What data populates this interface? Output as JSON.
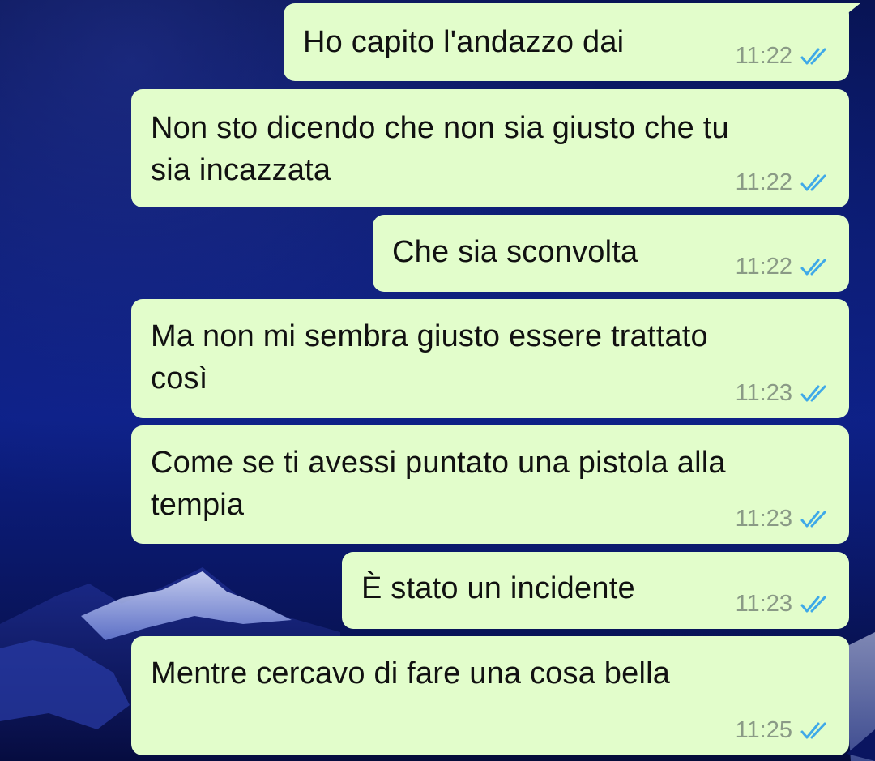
{
  "theme": {
    "bubble_color": "#e2fdcb",
    "read_tick_color": "#3fa9e8",
    "time_color": "#8a9a86"
  },
  "messages": [
    {
      "text": "Ho capito l'andazzo dai",
      "time": "11:22",
      "status_icon": "double-check-read-icon"
    },
    {
      "text": "Non sto dicendo che non sia giusto che tu\nsia incazzata",
      "time": "11:22",
      "status_icon": "double-check-read-icon"
    },
    {
      "text": "Che sia sconvolta",
      "time": "11:22",
      "status_icon": "double-check-read-icon"
    },
    {
      "text": "Ma non mi sembra giusto essere trattato\ncosì",
      "time": "11:23",
      "status_icon": "double-check-read-icon"
    },
    {
      "text": "Come se ti avessi puntato una pistola alla\ntempia",
      "time": "11:23",
      "status_icon": "double-check-read-icon"
    },
    {
      "text": "È stato un incidente",
      "time": "11:23",
      "status_icon": "double-check-read-icon"
    },
    {
      "text": "Mentre cercavo di fare una cosa bella",
      "time": "11:25",
      "status_icon": "double-check-read-icon"
    }
  ]
}
